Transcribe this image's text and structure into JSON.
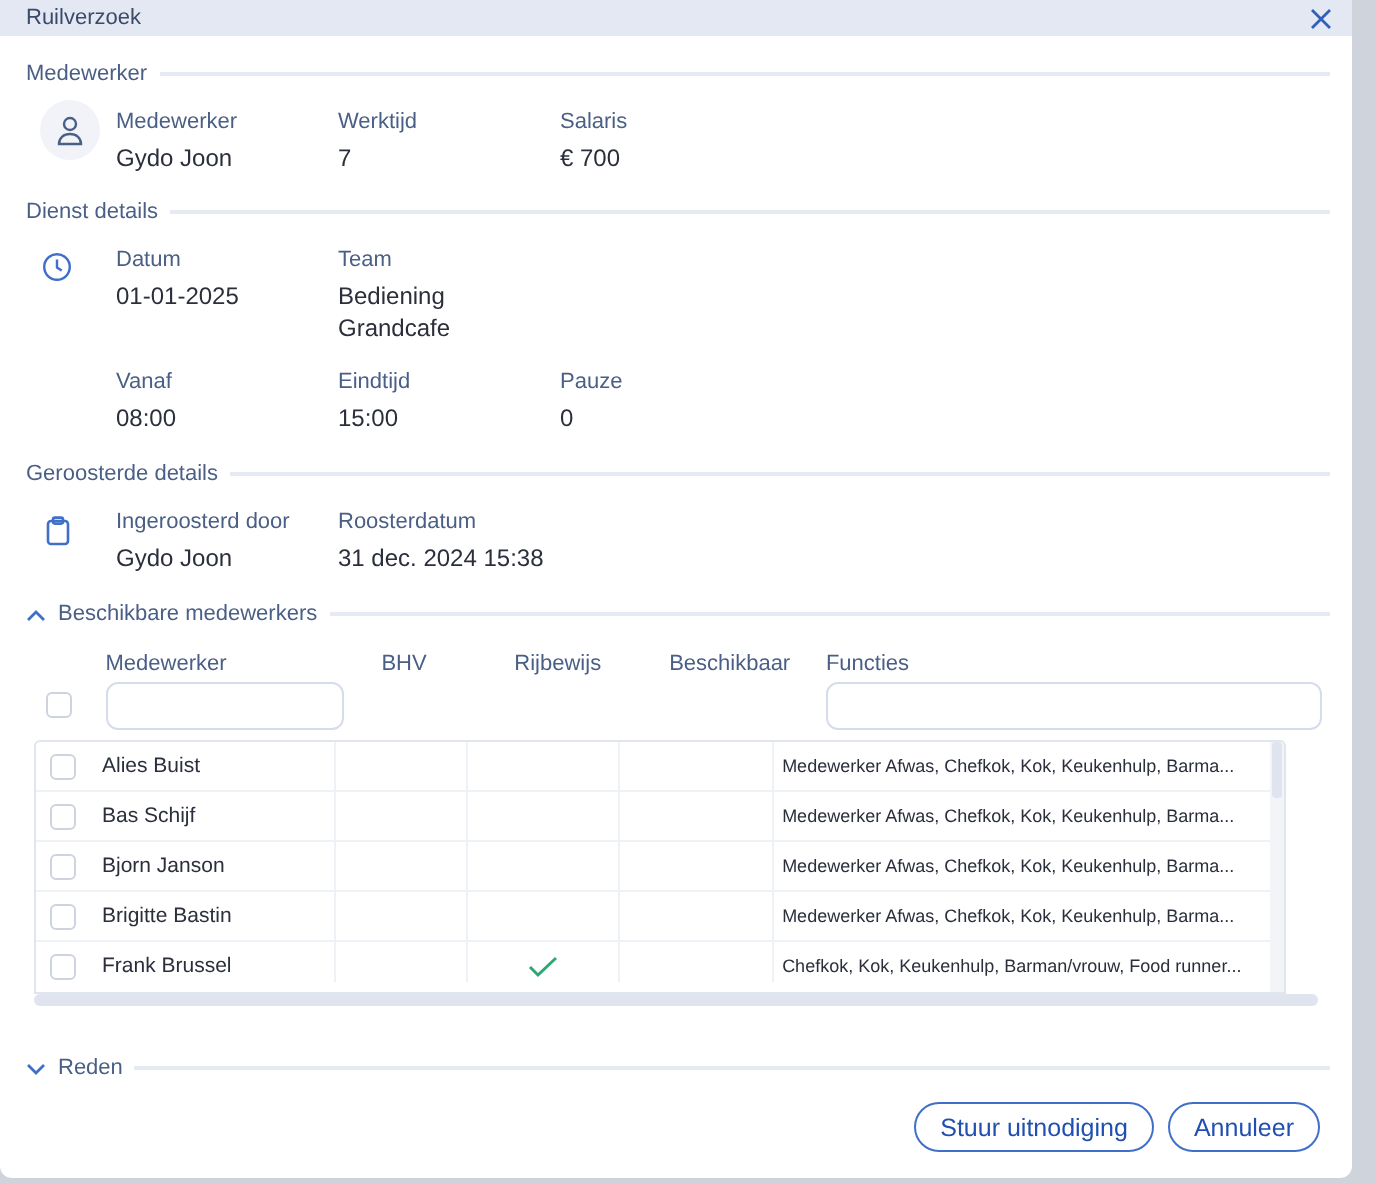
{
  "dialog": {
    "title": "Ruilverzoek"
  },
  "sections": [
    {
      "title": "Medewerker",
      "rows": [
        [
          {
            "label": "Medewerker",
            "value": "Gydo Joon"
          },
          {
            "label": "Werktijd",
            "value": "7"
          },
          {
            "label": "Salaris",
            "value": "€ 700"
          }
        ]
      ]
    },
    {
      "title": "Dienst details",
      "rows": [
        [
          {
            "label": "Datum",
            "value": "01-01-2025"
          },
          {
            "label": "Team",
            "value": "Bediening Grandcafe"
          }
        ],
        [
          {
            "label": "Vanaf",
            "value": "08:00"
          },
          {
            "label": "Eindtijd",
            "value": "15:00"
          },
          {
            "label": "Pauze",
            "value": "0"
          }
        ]
      ]
    },
    {
      "title": "Geroosterde details",
      "rows": [
        [
          {
            "label": "Ingeroosterd door",
            "value": "Gydo Joon"
          },
          {
            "label": "Roosterdatum",
            "value": "31 dec. 2024 15:38"
          }
        ]
      ]
    }
  ],
  "available": {
    "title": "Beschikbare medewerkers",
    "expanded": true,
    "select_all": false,
    "columns": [
      {
        "label": "Medewerker",
        "filter": true
      },
      {
        "label": "BHV",
        "filter": false
      },
      {
        "label": "Rijbewijs",
        "filter": false
      },
      {
        "label": "Beschikbaar",
        "filter": false
      },
      {
        "label": "Functies",
        "filter": true
      }
    ],
    "rows": [
      {
        "name": "Alies Buist",
        "selected": false,
        "rijbewijs": false,
        "functies": "Medewerker Afwas, Chefkok, Kok, Keukenhulp, Barma..."
      },
      {
        "name": "Bas Schijf",
        "selected": false,
        "rijbewijs": false,
        "functies": "Medewerker Afwas, Chefkok, Kok, Keukenhulp, Barma..."
      },
      {
        "name": "Bjorn Janson",
        "selected": false,
        "rijbewijs": false,
        "functies": "Medewerker Afwas, Chefkok, Kok, Keukenhulp, Barma..."
      },
      {
        "name": "Brigitte Bastin",
        "selected": false,
        "rijbewijs": false,
        "functies": "Medewerker Afwas, Chefkok, Kok, Keukenhulp, Barma..."
      },
      {
        "name": "Frank Brussel",
        "selected": false,
        "rijbewijs": true,
        "functies": "Chefkok, Kok, Keukenhulp, Barman/vrouw, Food runner..."
      }
    ]
  },
  "reason": {
    "title": "Reden",
    "expanded": false
  },
  "buttons": [
    "Stuur uitnodiging",
    "Annuleer"
  ]
}
